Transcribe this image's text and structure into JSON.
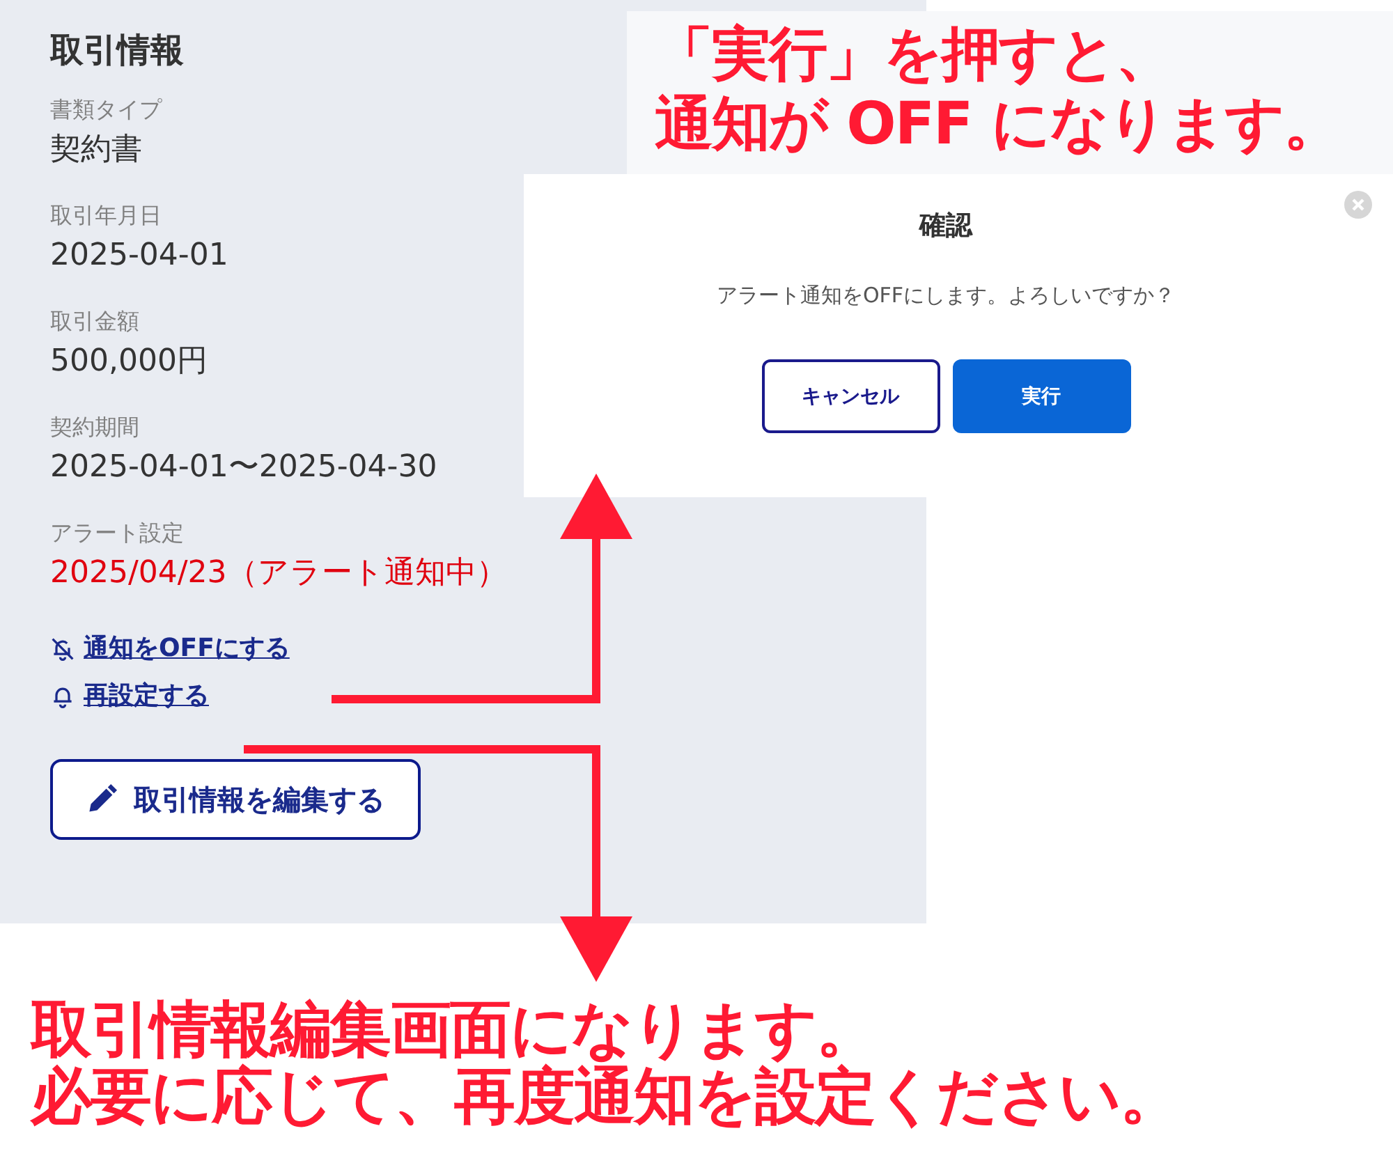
{
  "panel": {
    "title": "取引情報",
    "fields": [
      {
        "label": "書類タイプ",
        "value": "契約書",
        "kind": "normal"
      },
      {
        "label": "取引年月日",
        "value": "2025-04-01",
        "kind": "normal"
      },
      {
        "label": "取引金額",
        "value": "500,000円",
        "kind": "normal"
      },
      {
        "label": "契約期間",
        "value": "2025-04-01〜2025-04-30",
        "kind": "normal"
      },
      {
        "label": "アラート設定",
        "value": "2025/04/23（アラート通知中）",
        "kind": "alert"
      }
    ],
    "links": [
      {
        "label": "通知をOFFにする",
        "kind": "bell-off"
      },
      {
        "label": "再設定する",
        "kind": "bell"
      }
    ],
    "edit_button": "取引情報を編集する"
  },
  "dialog": {
    "title": "確認",
    "message": "アラート通知をOFFにします。よろしいですか？",
    "buttons": [
      {
        "label": "キャンセル",
        "kind": "secondary"
      },
      {
        "label": "実行",
        "kind": "primary"
      }
    ]
  },
  "annotations": {
    "top": [
      "「実行」を押すと、",
      "通知が OFF になります。"
    ],
    "bottom": [
      "取引情報編集画面になります。",
      "必要に応じて、再度通知を設定ください。"
    ]
  }
}
